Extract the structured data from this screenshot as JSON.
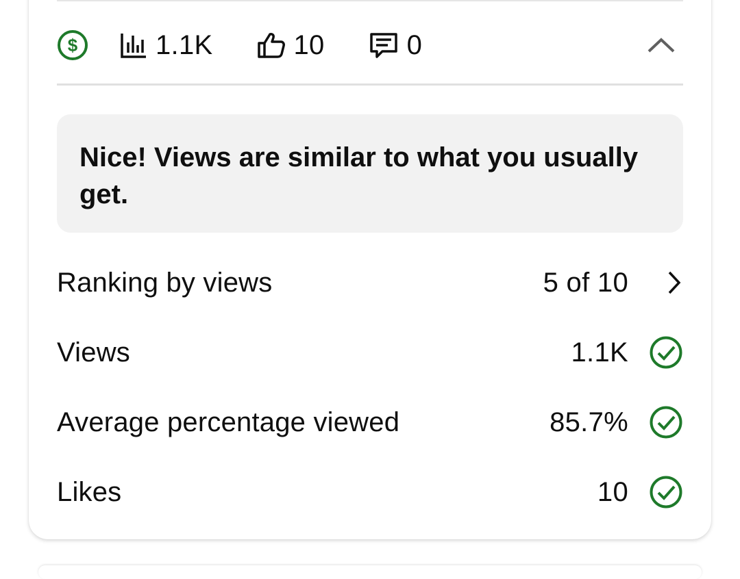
{
  "stats": {
    "views": "1.1K",
    "likes": "10",
    "comments": "0"
  },
  "insight": {
    "text": "Nice! Views are similar to what you usually get."
  },
  "metrics": [
    {
      "label": "Ranking by views",
      "value": "5 of 10",
      "trail_icon": "chevron-right-icon"
    },
    {
      "label": "Views",
      "value": "1.1K",
      "trail_icon": "check-circle-icon"
    },
    {
      "label": "Average percentage viewed",
      "value": "85.7%",
      "trail_icon": "check-circle-icon"
    },
    {
      "label": "Likes",
      "value": "10",
      "trail_icon": "check-circle-icon"
    }
  ],
  "icons": {
    "monetization": "dollar-circle-icon",
    "views": "bar-chart-icon",
    "likes": "thumbs-up-icon",
    "comments": "comment-icon",
    "collapse": "chevron-up-icon"
  },
  "colors": {
    "success_green": "#1e7a2a",
    "text": "#0f0f0f",
    "muted_icon": "#606060",
    "insight_bg": "#f2f2f2"
  }
}
